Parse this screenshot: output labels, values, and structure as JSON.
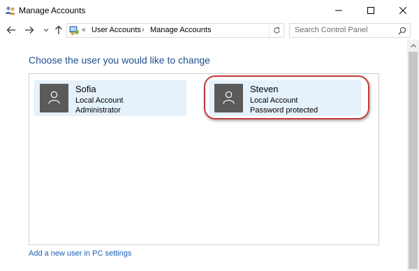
{
  "window": {
    "title": "Manage Accounts",
    "title_icon": "users-icon"
  },
  "nav": {
    "back_icon": "arrow-left-icon",
    "forward_icon": "arrow-right-icon",
    "recent_icon": "chevron-down-icon",
    "up_icon": "arrow-up-icon"
  },
  "address": {
    "overflow_chevron": "«",
    "breadcrumbs": [
      "User Accounts",
      "Manage Accounts"
    ],
    "separator": "›"
  },
  "search": {
    "placeholder": "Search Control Panel"
  },
  "main": {
    "heading": "Choose the user you would like to change",
    "accounts": [
      {
        "name": "Sofia",
        "type": "Local Account",
        "detail": "Administrator"
      },
      {
        "name": "Steven",
        "type": "Local Account",
        "detail": "Password protected"
      }
    ],
    "add_user_link": "Add a new user in PC settings"
  },
  "colors": {
    "heading": "#1e4e8c",
    "tile_bg": "#e5f1fb",
    "avatar_bg": "#5a5a5a",
    "highlight": "#c23a3a",
    "link": "#1a5fb4"
  }
}
